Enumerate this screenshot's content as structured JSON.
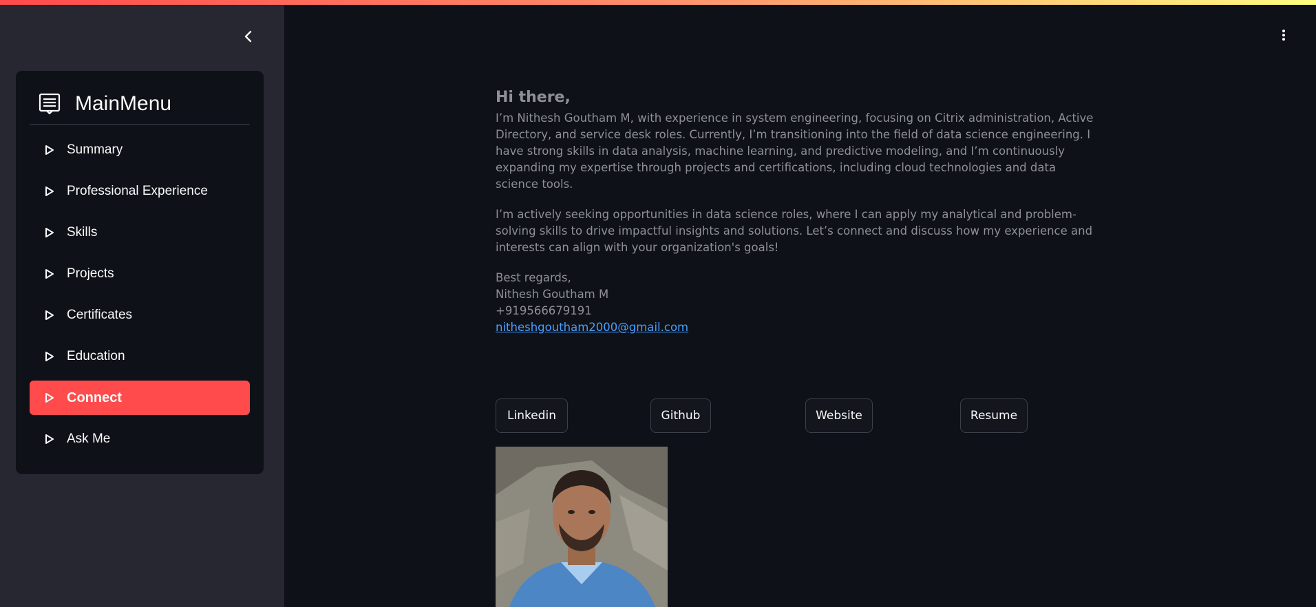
{
  "sidebar": {
    "collapse_icon": "chevron-left-icon",
    "menu_icon": "menu-list-icon",
    "menu_title": "MainMenu",
    "items": [
      {
        "label": "Summary",
        "active": false
      },
      {
        "label": "Professional Experience",
        "active": false
      },
      {
        "label": "Skills",
        "active": false
      },
      {
        "label": "Projects",
        "active": false
      },
      {
        "label": "Certificates",
        "active": false
      },
      {
        "label": "Education",
        "active": false
      },
      {
        "label": "Connect",
        "active": true
      },
      {
        "label": "Ask Me",
        "active": false
      }
    ]
  },
  "header": {
    "menu_icon": "kebab-menu-icon"
  },
  "main": {
    "greeting": "Hi there,",
    "intro": "I’m Nithesh Goutham M, with experience in system engineering, focusing on Citrix administration, Active Directory, and service desk roles. Currently, I’m transitioning into the field of data science engineering. I have strong skills in data analysis, machine learning, and predictive modeling, and I’m continuously expanding my expertise through projects and certifications, including cloud technologies and data science tools.",
    "seeking": "I’m actively seeking opportunities in data science roles, where I can apply my analytical and problem-solving skills to drive impactful insights and solutions. Let’s connect and discuss how my experience and interests can align with your organization's goals!",
    "signoff": "Best regards,",
    "name": "Nithesh Goutham M",
    "phone": "+919566679191",
    "email": "nitheshgoutham2000@gmail.com",
    "buttons": {
      "linkedin": "Linkedin",
      "github": "Github",
      "website": "Website",
      "resume": "Resume"
    }
  },
  "colors": {
    "accent": "#ff4b4b",
    "background": "#0e1117",
    "sidebar": "#262730",
    "link": "#4a9eff"
  }
}
